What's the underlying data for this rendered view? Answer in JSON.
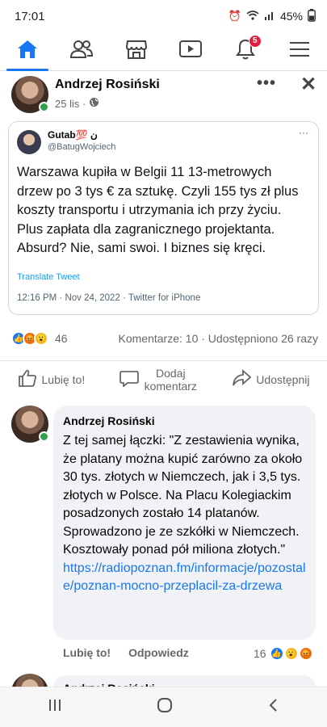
{
  "status_bar": {
    "time": "17:01",
    "battery": "45%"
  },
  "nav": {
    "items": [
      "home",
      "friends",
      "marketplace",
      "watch",
      "notifications",
      "menu"
    ],
    "notifications_badge": "5"
  },
  "post": {
    "author": "Andrzej Rosiński",
    "date": "25 lis ·",
    "more_label": "•••",
    "close_label": "✕"
  },
  "tweet": {
    "display_name": "Gutab💯 ن",
    "handle": "@BatugWojciech",
    "more": "···",
    "text": "Warszawa kupiła w Belgii 11 13-metrowych drzew po 3 tys € za sztukę. Czyli 155 tys zł plus koszty transportu i utrzymania ich przy życiu. Plus zapłata dla zagranicznego projektanta. Absurd? Nie, sami swoi. I biznes się kręci.",
    "translate": "Translate Tweet",
    "timestamp": "12:16 PM · Nov 24, 2022 · Twitter for iPhone"
  },
  "reactions": {
    "count": "46",
    "summary": "Komentarze: 10 · Udostępniono 26 razy"
  },
  "actions": {
    "like": "Lubię to!",
    "comment": "Dodaj komentarz",
    "share": "Udostępnij"
  },
  "comment": {
    "author": "Andrzej Rosiński",
    "text": "Z tej samej łączki: \"Z zestawienia wynika, że platany można kupić zarówno za około 30 tys. złotych w Niemczech, jak i 3,5 tys. złotych w Polsce. Na Placu Kolegiackim posadzonych zostało 14 platanów. Sprowadzono je ze szkółki w Niemczech. Kosztowały ponad pół miliona złotych.\"",
    "link": "https://radiopoznan.fm/informacje/pozostale/poznan-mocno-przeplacil-za-drzewa",
    "like": "Lubię to!",
    "reply": "Odpowiedz",
    "reaction_count": "16"
  },
  "next_comment": {
    "author": "Andrzej Rosiński"
  },
  "colors": {
    "accent": "#1877f2",
    "online": "#31a24c",
    "badge": "#e41e3f"
  }
}
